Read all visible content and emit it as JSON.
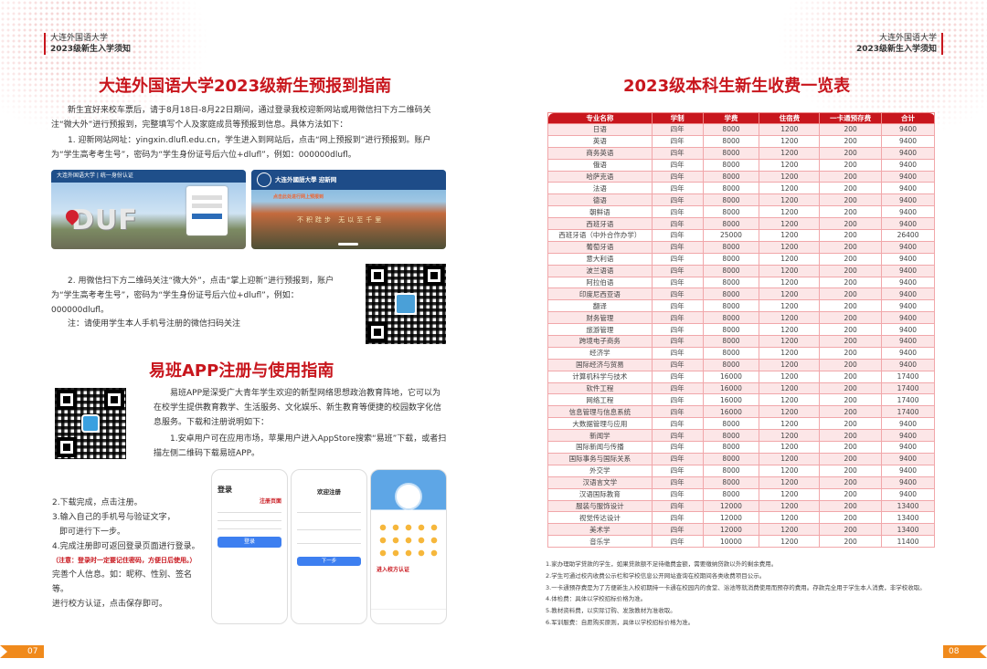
{
  "left": {
    "header": {
      "line1": "大连外国语大学",
      "line2": "2023级新生入学须知"
    },
    "title1": "大连外国语大学2023级新生预报到指南",
    "intro": "新生宜好来校车票后，请于8月18日-8月22日期间，通过登录我校迎新网站或用微信扫下方二维码关注“微大外”进行预报到，完整填写个人及家庭成员等预报到信息。具体方法如下：",
    "step1": "1. 迎新网站网址：yingxin.dlufl.edu.cn，学生进入到网站后，点击“网上预报到”进行预报到。账户为“学生高考考生号”，密码为“学生身份证号后六位+dlufl”，例如：000000dlufl。",
    "photo1": {
      "sign": "DUF",
      "banner": "大连外国语大学 | 统一身份认证"
    },
    "photo2": {
      "banner": "大连外國語大學 迎新网",
      "note": "点击此处进行网上预报到",
      "rock": "不积跬步 无以至千里"
    },
    "step2": "2. 用微信扫下方二维码关注“微大外”，点击“掌上迎新”进行预报到，账户为“学生高考考生号”，密码为“学生身份证号后六位+dlufl”，例如：000000dlufl。",
    "step2_note": "注：请使用学生本人手机号注册的微信扫码关注",
    "title2": "易班APP注册与使用指南",
    "yiban_intro": "易班APP是深受广大青年学生欢迎的新型网络思想政治教育阵地，它可以为在校学生提供教育教学、生活服务、文化娱乐、新生教育等便捷的校园数字化信息服务。下载和注册说明如下：",
    "yiban_step1": "1.安卓用户可在应用市场，苹果用户进入AppStore搜索“易班”下载，或者扫描左侧二维码下载易班APP。",
    "yiban_steps": [
      "2.下载完成，点击注册。",
      "3.输入自己的手机号与验证文字，",
      "即可进行下一步。",
      "4.完成注册即可返回登录页面进行登录。",
      "（注意：登录时一定要记住密码，方便日后使用。）",
      "完善个人信息。如：昵称、性别、签名等。",
      "进行校方认证，点击保存即可。"
    ],
    "phone1": {
      "title": "登录",
      "label": "注册页面",
      "btn": "登录"
    },
    "phone2": {
      "title": "欢迎注册",
      "btn": "下一步"
    },
    "phone3": {
      "label": "进入校方认证"
    },
    "page_num": "07"
  },
  "right": {
    "header": {
      "line1": "大连外国语大学",
      "line2": "2023级新生入学须知"
    },
    "title": "2023级本科生新生收费一览表",
    "columns": [
      "专业名称",
      "学制",
      "学费",
      "住宿费",
      "一卡通预存费",
      "合计"
    ],
    "rows": [
      [
        "日语",
        "四年",
        "8000",
        "1200",
        "200",
        "9400"
      ],
      [
        "英语",
        "四年",
        "8000",
        "1200",
        "200",
        "9400"
      ],
      [
        "商务英语",
        "四年",
        "8000",
        "1200",
        "200",
        "9400"
      ],
      [
        "俄语",
        "四年",
        "8000",
        "1200",
        "200",
        "9400"
      ],
      [
        "哈萨克语",
        "四年",
        "8000",
        "1200",
        "200",
        "9400"
      ],
      [
        "法语",
        "四年",
        "8000",
        "1200",
        "200",
        "9400"
      ],
      [
        "德语",
        "四年",
        "8000",
        "1200",
        "200",
        "9400"
      ],
      [
        "朝鲜语",
        "四年",
        "8000",
        "1200",
        "200",
        "9400"
      ],
      [
        "西班牙语",
        "四年",
        "8000",
        "1200",
        "200",
        "9400"
      ],
      [
        "西班牙语（中外合作办学）",
        "四年",
        "25000",
        "1200",
        "200",
        "26400"
      ],
      [
        "葡萄牙语",
        "四年",
        "8000",
        "1200",
        "200",
        "9400"
      ],
      [
        "意大利语",
        "四年",
        "8000",
        "1200",
        "200",
        "9400"
      ],
      [
        "波兰语语",
        "四年",
        "8000",
        "1200",
        "200",
        "9400"
      ],
      [
        "阿拉伯语",
        "四年",
        "8000",
        "1200",
        "200",
        "9400"
      ],
      [
        "印度尼西亚语",
        "四年",
        "8000",
        "1200",
        "200",
        "9400"
      ],
      [
        "翻译",
        "四年",
        "8000",
        "1200",
        "200",
        "9400"
      ],
      [
        "财务管理",
        "四年",
        "8000",
        "1200",
        "200",
        "9400"
      ],
      [
        "旅游管理",
        "四年",
        "8000",
        "1200",
        "200",
        "9400"
      ],
      [
        "跨境电子商务",
        "四年",
        "8000",
        "1200",
        "200",
        "9400"
      ],
      [
        "经济学",
        "四年",
        "8000",
        "1200",
        "200",
        "9400"
      ],
      [
        "国际经济与贸易",
        "四年",
        "8000",
        "1200",
        "200",
        "9400"
      ],
      [
        "计算机科学与技术",
        "四年",
        "16000",
        "1200",
        "200",
        "17400"
      ],
      [
        "软件工程",
        "四年",
        "16000",
        "1200",
        "200",
        "17400"
      ],
      [
        "网络工程",
        "四年",
        "16000",
        "1200",
        "200",
        "17400"
      ],
      [
        "信息管理与信息系统",
        "四年",
        "16000",
        "1200",
        "200",
        "17400"
      ],
      [
        "大数据管理与应用",
        "四年",
        "8000",
        "1200",
        "200",
        "9400"
      ],
      [
        "新闻学",
        "四年",
        "8000",
        "1200",
        "200",
        "9400"
      ],
      [
        "国际新闻与传播",
        "四年",
        "8000",
        "1200",
        "200",
        "9400"
      ],
      [
        "国际事务与国际关系",
        "四年",
        "8000",
        "1200",
        "200",
        "9400"
      ],
      [
        "外交学",
        "四年",
        "8000",
        "1200",
        "200",
        "9400"
      ],
      [
        "汉语言文学",
        "四年",
        "8000",
        "1200",
        "200",
        "9400"
      ],
      [
        "汉语国际教育",
        "四年",
        "8000",
        "1200",
        "200",
        "9400"
      ],
      [
        "服装与服饰设计",
        "四年",
        "12000",
        "1200",
        "200",
        "13400"
      ],
      [
        "视觉传达设计",
        "四年",
        "12000",
        "1200",
        "200",
        "13400"
      ],
      [
        "美术学",
        "四年",
        "12000",
        "1200",
        "200",
        "13400"
      ],
      [
        "音乐学",
        "四年",
        "10000",
        "1200",
        "200",
        "11400"
      ]
    ],
    "notes": [
      "1.家办理助学贷款的学生，如果贷款额不足待缴费金额，需要缴纳贷款以外的剩余费用。",
      "2.学生可通过校内收费公示栏和学校信息公开网站查询在校期间各类收费项目公示。",
      "3.一卡通预存费是为了方便新生入校初期持一卡通在校园内的食堂、浴池等就消费使用而预存的费用。存款完全用于学生本人消费，非学校收取。",
      "4.体检费：具体以学校招标价格为准。",
      "5.教材资料费，以实际订购、发放教材为准收取。",
      "6.军训服费：自愿购买原则，具体以学校招标价格为准。"
    ],
    "page_num": "08"
  }
}
